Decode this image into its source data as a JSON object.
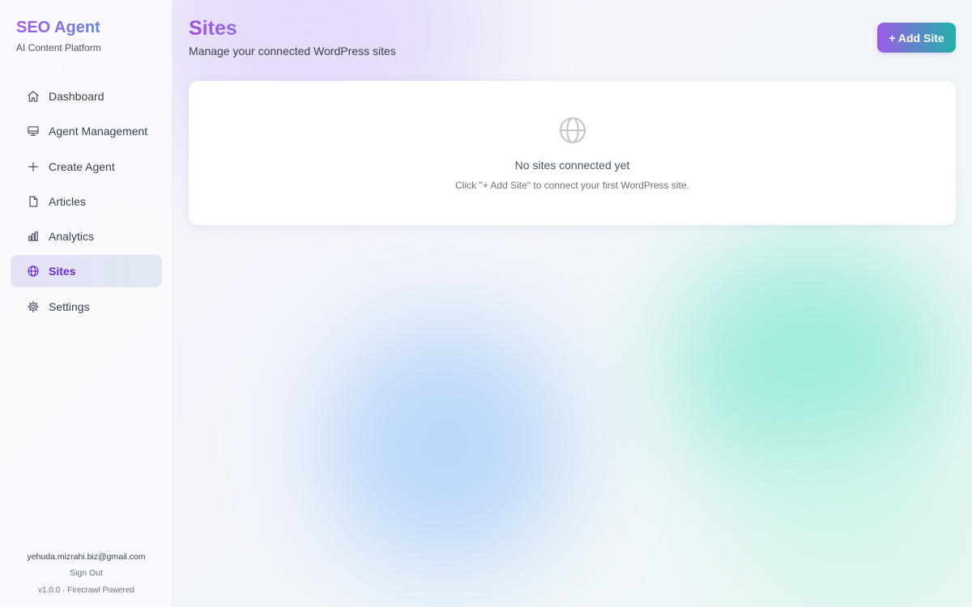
{
  "brand": {
    "title": "SEO Agent",
    "subtitle": "AI Content Platform"
  },
  "sidebar": {
    "items": [
      {
        "label": "Dashboard",
        "icon": "home-icon",
        "active": false
      },
      {
        "label": "Agent Management",
        "icon": "monitor-icon",
        "active": false
      },
      {
        "label": "Create Agent",
        "icon": "plus-icon",
        "active": false
      },
      {
        "label": "Articles",
        "icon": "file-icon",
        "active": false
      },
      {
        "label": "Analytics",
        "icon": "bar-chart-icon",
        "active": false
      },
      {
        "label": "Sites",
        "icon": "globe-icon",
        "active": true
      },
      {
        "label": "Settings",
        "icon": "gear-icon",
        "active": false
      }
    ],
    "footer": {
      "email": "yehuda.mizrahi.biz@gmail.com",
      "sign_out": "Sign Out",
      "version": "v1.0.0 · Firecrawl Powered"
    }
  },
  "header": {
    "title": "Sites",
    "subtitle": "Manage your connected WordPress sites",
    "add_button": "+ Add Site"
  },
  "empty_state": {
    "icon": "globe-icon",
    "title": "No sites connected yet",
    "description": "Click \"+ Add Site\" to connect your first WordPress site."
  },
  "colors": {
    "accent": "#6d28c9",
    "brand_gradient_start": "#a15ae6",
    "button_gradient_end": "#1fb3a8"
  }
}
